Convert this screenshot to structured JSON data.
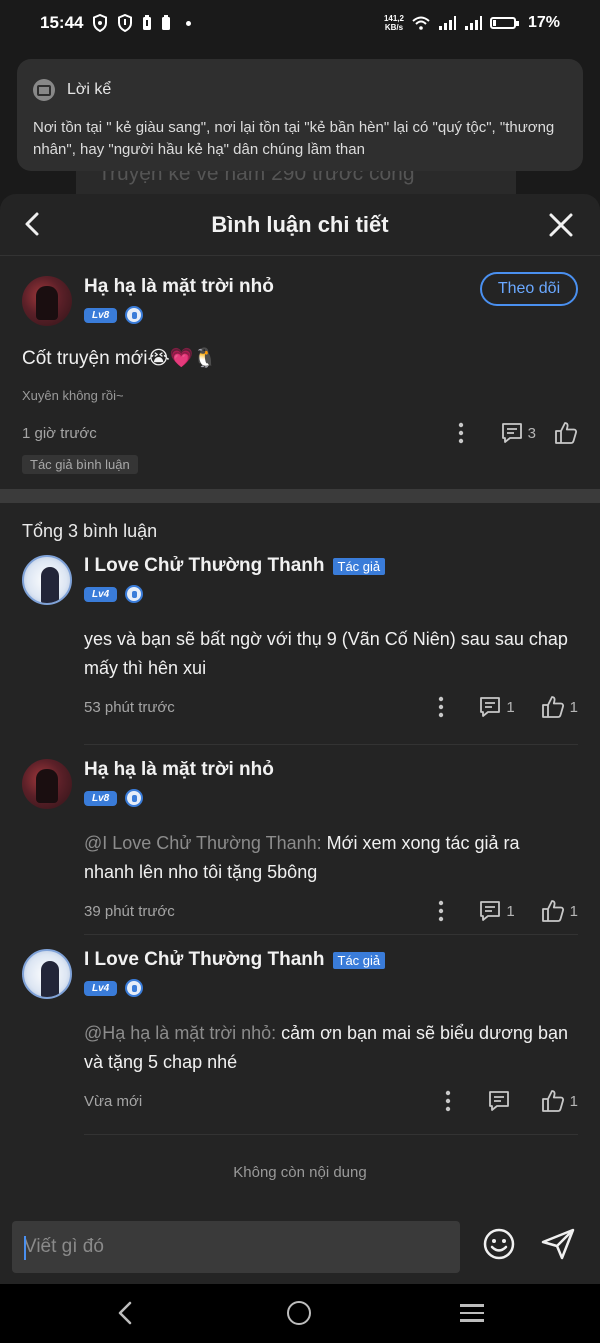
{
  "status": {
    "time": "15:44",
    "net_speed_value": "141,2",
    "net_speed_unit": "KB/s",
    "battery": "17%",
    "battery_level": 0.17
  },
  "background": {
    "text": "Truyện kể về năm 290 trước công"
  },
  "popup": {
    "title": "Lời kể",
    "text": "Nơi tồn tại \" kẻ giàu sang\", nơi lại tồn tại \"kẻ bần hèn\" lại có \"quý tộc\", \"thương nhân\", hay \"người hầu kẻ hạ\" dân chúng lầm than"
  },
  "header": {
    "title": "Bình luận chi tiết"
  },
  "main_comment": {
    "author": "Hạ hạ là mặt trời nhỏ",
    "level": "Lv8",
    "follow_label": "Theo dõi",
    "text": "Cốt truyện mới😭💗🐧",
    "sub": "Xuyên không rồi~",
    "time": "1 giờ trước",
    "reply_count": "3",
    "tag": "Tác giả bình luận"
  },
  "list": {
    "total": "Tổng 3 bình luận",
    "replies": [
      {
        "author": "I Love Chử Thường Thanh",
        "badge": "Tác giả",
        "level": "Lv4",
        "mention": "",
        "text": "yes và bạn sẽ bất ngờ với thụ 9 (Vãn Cố Niên) sau sau chap mấy thì hên xui",
        "time": "53 phút trước",
        "reply_count": "1",
        "like_count": "1"
      },
      {
        "author": "Hạ hạ là mặt trời nhỏ",
        "badge": "",
        "level": "Lv8",
        "mention": "@I Love Chử Thường Thanh: ",
        "text": "Mới xem xong tác giả ra nhanh lên nho tôi tặng 5bông",
        "time": "39 phút trước",
        "reply_count": "1",
        "like_count": "1"
      },
      {
        "author": "I Love Chử Thường Thanh",
        "badge": "Tác giả",
        "level": "Lv4",
        "mention": "@Hạ hạ là mặt trời nhỏ: ",
        "text": "cảm ơn bạn mai sẽ biểu dương bạn và tặng 5 chap nhé",
        "time": "Vừa mới",
        "reply_count": "",
        "like_count": "1"
      }
    ],
    "end_text": "Không còn nội dung"
  },
  "input": {
    "placeholder": "Viết gì đó"
  },
  "colors": {
    "accent": "#3a7cd9",
    "background": "#242424"
  }
}
